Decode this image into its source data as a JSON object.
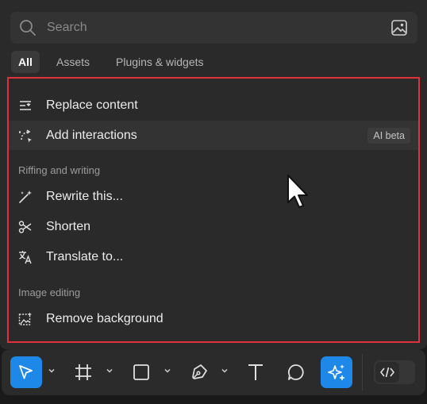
{
  "search": {
    "placeholder": "Search"
  },
  "tabs": [
    {
      "label": "All",
      "active": true
    },
    {
      "label": "Assets",
      "active": false
    },
    {
      "label": "Plugins & widgets",
      "active": false
    }
  ],
  "menu": {
    "items": [
      {
        "label": "Replace content",
        "icon": "replace-content-icon"
      },
      {
        "label": "Add interactions",
        "icon": "add-interactions-icon",
        "badge": "AI beta"
      }
    ],
    "sections": [
      {
        "title": "Riffing and writing",
        "items": [
          {
            "label": "Rewrite this...",
            "icon": "magic-wand-icon"
          },
          {
            "label": "Shorten",
            "icon": "scissors-icon"
          },
          {
            "label": "Translate to...",
            "icon": "translate-icon"
          }
        ]
      },
      {
        "title": "Image editing",
        "items": [
          {
            "label": "Remove background",
            "icon": "remove-background-icon"
          }
        ]
      }
    ]
  },
  "toolbar": {
    "tools": [
      "move-tool",
      "frame-tool",
      "shape-tool",
      "pen-tool",
      "text-tool",
      "comment-tool",
      "actions-tool",
      "dev-mode-toggle"
    ],
    "active_tool": "actions-tool",
    "accent_color": "#1d88e8"
  },
  "highlight_color": "#e0303c"
}
